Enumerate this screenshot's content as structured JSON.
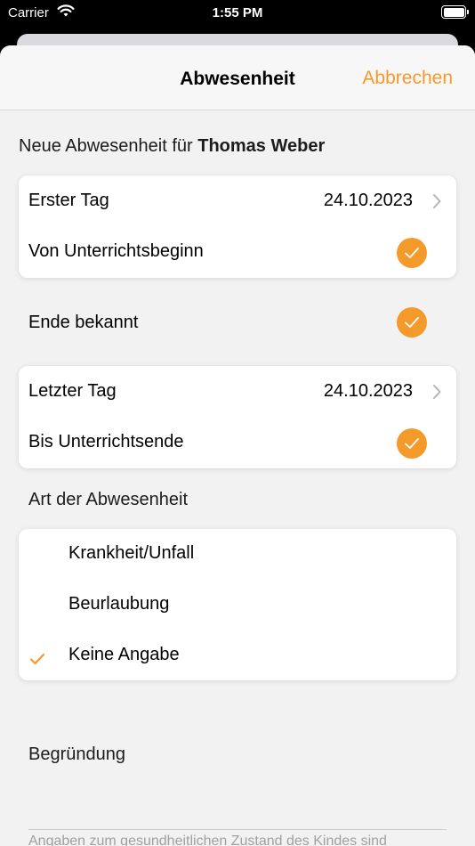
{
  "status_bar": {
    "carrier": "Carrier",
    "time": "1:55 PM"
  },
  "nav": {
    "title": "Abwesenheit",
    "cancel_label": "Abbrechen"
  },
  "header": {
    "prefix": "Neue Abwesenheit für ",
    "name": "Thomas Weber"
  },
  "start": {
    "first_day_label": "Erster Tag",
    "first_day_value": "24.10.2023",
    "from_start_label": "Von Unterrichtsbeginn",
    "from_start_checked": true
  },
  "end_known": {
    "label": "Ende bekannt",
    "checked": true
  },
  "end": {
    "last_day_label": "Letzter Tag",
    "last_day_value": "24.10.2023",
    "until_end_label": "Bis Unterrichtsende",
    "until_end_checked": true
  },
  "absence_type": {
    "header": "Art der Abwesenheit",
    "options": [
      {
        "label": "Krankheit/Unfall",
        "selected": false
      },
      {
        "label": "Beurlaubung",
        "selected": false
      },
      {
        "label": "Keine Angabe",
        "selected": true
      }
    ]
  },
  "reason": {
    "label": "Begründung",
    "footnote": "Angaben zum gesundheitlichen Zustand des Kindes sind"
  },
  "colors": {
    "accent": "#f49a2a",
    "background": "#f2f2f2"
  }
}
